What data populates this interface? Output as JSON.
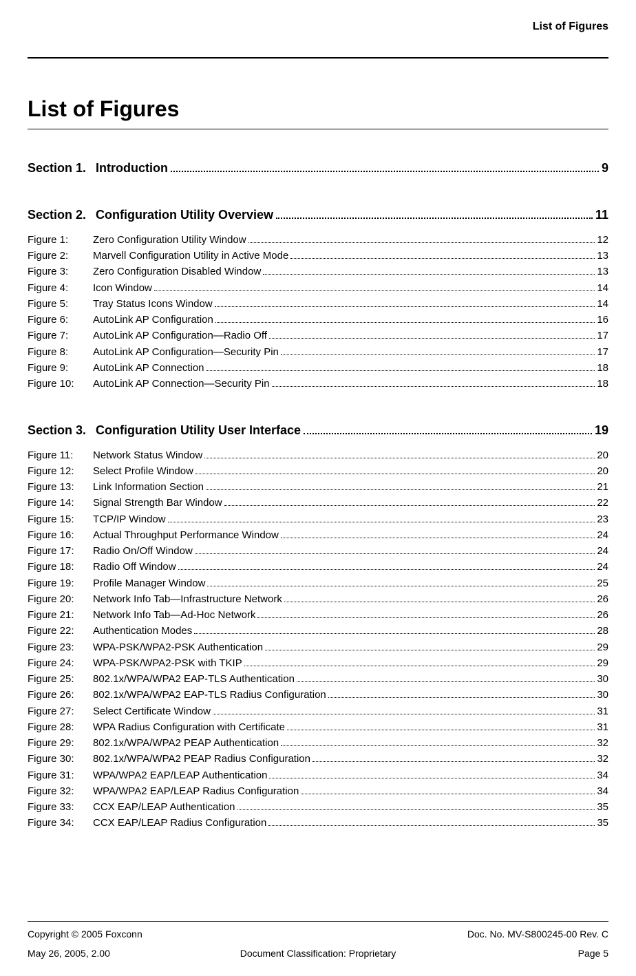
{
  "runningHeader": "List of Figures",
  "pageTitle": "List of Figures",
  "sections": [
    {
      "label": "Section 1.",
      "title": "Introduction",
      "page": "9",
      "figures": []
    },
    {
      "label": "Section 2.",
      "title": "Configuration Utility Overview",
      "page": "11",
      "figures": [
        {
          "label": "Figure 1:",
          "title": "Zero Configuration Utility Window",
          "page": "12"
        },
        {
          "label": "Figure 2:",
          "title": "Marvell Configuration Utility in Active Mode",
          "page": "13"
        },
        {
          "label": "Figure 3:",
          "title": "Zero Configuration Disabled Window",
          "page": "13"
        },
        {
          "label": "Figure 4:",
          "title": "Icon Window",
          "page": "14"
        },
        {
          "label": "Figure 5:",
          "title": "Tray Status Icons Window",
          "page": "14"
        },
        {
          "label": "Figure 6:",
          "title": "AutoLink AP Configuration",
          "page": "16"
        },
        {
          "label": "Figure 7:",
          "title": "AutoLink AP Configuration—Radio Off",
          "page": "17"
        },
        {
          "label": "Figure 8:",
          "title": "AutoLink AP Configuration—Security Pin",
          "page": "17"
        },
        {
          "label": "Figure 9:",
          "title": "AutoLink AP Connection",
          "page": "18"
        },
        {
          "label": "Figure 10:",
          "title": "AutoLink AP Connection—Security Pin",
          "page": "18"
        }
      ]
    },
    {
      "label": "Section 3.",
      "title": "Configuration Utility User Interface",
      "page": "19",
      "figures": [
        {
          "label": "Figure 11:",
          "title": "Network Status Window",
          "page": "20"
        },
        {
          "label": "Figure 12:",
          "title": "Select Profile Window",
          "page": "20"
        },
        {
          "label": "Figure 13:",
          "title": "Link Information Section",
          "page": "21"
        },
        {
          "label": "Figure 14:",
          "title": "Signal Strength Bar Window",
          "page": "22"
        },
        {
          "label": "Figure 15:",
          "title": "TCP/IP Window",
          "page": "23"
        },
        {
          "label": "Figure 16:",
          "title": "Actual Throughput Performance Window",
          "page": "24"
        },
        {
          "label": "Figure 17:",
          "title": "Radio On/Off Window",
          "page": "24"
        },
        {
          "label": "Figure 18:",
          "title": "Radio Off Window",
          "page": "24"
        },
        {
          "label": "Figure 19:",
          "title": "Profile Manager Window",
          "page": "25"
        },
        {
          "label": "Figure 20:",
          "title": "Network Info Tab—Infrastructure Network",
          "page": "26"
        },
        {
          "label": "Figure 21:",
          "title": "Network Info Tab—Ad-Hoc Network",
          "page": "26"
        },
        {
          "label": "Figure 22:",
          "title": "Authentication Modes",
          "page": "28"
        },
        {
          "label": "Figure 23:",
          "title": "WPA-PSK/WPA2-PSK Authentication",
          "page": "29"
        },
        {
          "label": "Figure 24:",
          "title": "WPA-PSK/WPA2-PSK with TKIP",
          "page": "29"
        },
        {
          "label": "Figure 25:",
          "title": "802.1x/WPA/WPA2 EAP-TLS Authentication",
          "page": "30"
        },
        {
          "label": "Figure 26:",
          "title": "802.1x/WPA/WPA2 EAP-TLS Radius Configuration",
          "page": "30"
        },
        {
          "label": "Figure 27:",
          "title": "Select Certificate Window",
          "page": "31"
        },
        {
          "label": "Figure 28:",
          "title": "WPA Radius Configuration with Certificate",
          "page": "31"
        },
        {
          "label": "Figure 29:",
          "title": "802.1x/WPA/WPA2 PEAP Authentication",
          "page": "32"
        },
        {
          "label": "Figure 30:",
          "title": "802.1x/WPA/WPA2 PEAP Radius Configuration",
          "page": "32"
        },
        {
          "label": "Figure 31:",
          "title": "WPA/WPA2 EAP/LEAP Authentication",
          "page": "34"
        },
        {
          "label": "Figure 32:",
          "title": "WPA/WPA2 EAP/LEAP Radius Configuration",
          "page": "34"
        },
        {
          "label": "Figure 33:",
          "title": "CCX EAP/LEAP Authentication",
          "page": "35"
        },
        {
          "label": "Figure 34:",
          "title": "CCX EAP/LEAP Radius Configuration",
          "page": "35"
        }
      ]
    }
  ],
  "footer": {
    "copyright": "Copyright © 2005 Foxconn",
    "docNo": "Doc. No. MV-S800245-00 Rev. C",
    "date": "May 26, 2005, 2.00",
    "classification": "Document Classification: Proprietary",
    "pageLabel": "Page 5"
  }
}
